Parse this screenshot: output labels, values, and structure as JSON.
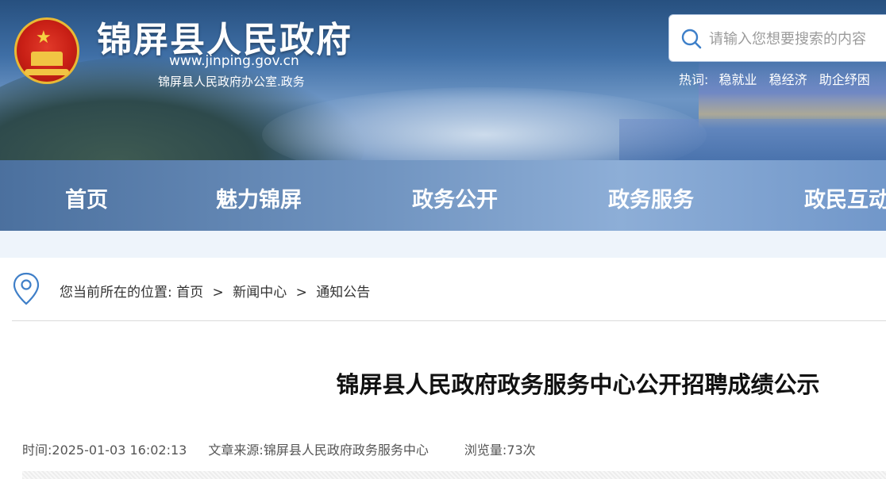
{
  "header": {
    "site_title": "锦屏县人民政府",
    "site_url": "www.jinping.gov.cn",
    "site_office": "锦屏县人民政府办公室.政务",
    "search": {
      "placeholder": "请输入您想要搜索的内容"
    },
    "hot_words_label": "热词:",
    "hot_words": [
      "稳就业",
      "稳经济",
      "助企纾困"
    ]
  },
  "nav": {
    "items": [
      "首页",
      "魅力锦屏",
      "政务公开",
      "政务服务",
      "政民互动"
    ]
  },
  "breadcrumb": {
    "prefix": "您当前所在的位置:",
    "items": [
      "首页",
      "新闻中心",
      "通知公告"
    ],
    "separator": ">"
  },
  "article": {
    "title": "锦屏县人民政府政务服务中心公开招聘成绩公示",
    "time": "时间:2025-01-03 16:02:13",
    "source": "文章来源:锦屏县人民政府政务服务中心",
    "views": "浏览量:73次"
  }
}
